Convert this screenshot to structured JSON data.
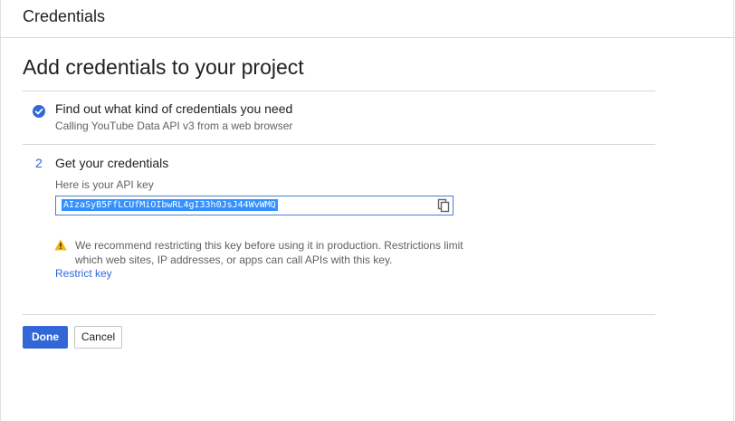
{
  "header": {
    "title": "Credentials"
  },
  "main": {
    "title": "Add credentials to your project",
    "step1": {
      "icon": "check-circle-icon",
      "title": "Find out what kind of credentials you need",
      "subtitle": "Calling YouTube Data API v3 from a web browser"
    },
    "step2": {
      "number": "2",
      "title": "Get your credentials",
      "api_key_label": "Here is your API key",
      "api_key_value": "AIzaSyB5FfLCUfMiOIbwRL4gI33h0JsJ44WvWMQ",
      "copy_icon": "copy-icon",
      "warning_icon": "warning-icon",
      "warning_text": "We recommend restricting this key before using it in production. Restrictions limit which web sites, IP addresses, or apps can call APIs with this key.",
      "restrict_link": "Restrict key"
    },
    "actions": {
      "done_label": "Done",
      "cancel_label": "Cancel"
    }
  },
  "colors": {
    "accent": "#3367d6",
    "warning": "#f4b400",
    "selection": "#3390ff"
  }
}
